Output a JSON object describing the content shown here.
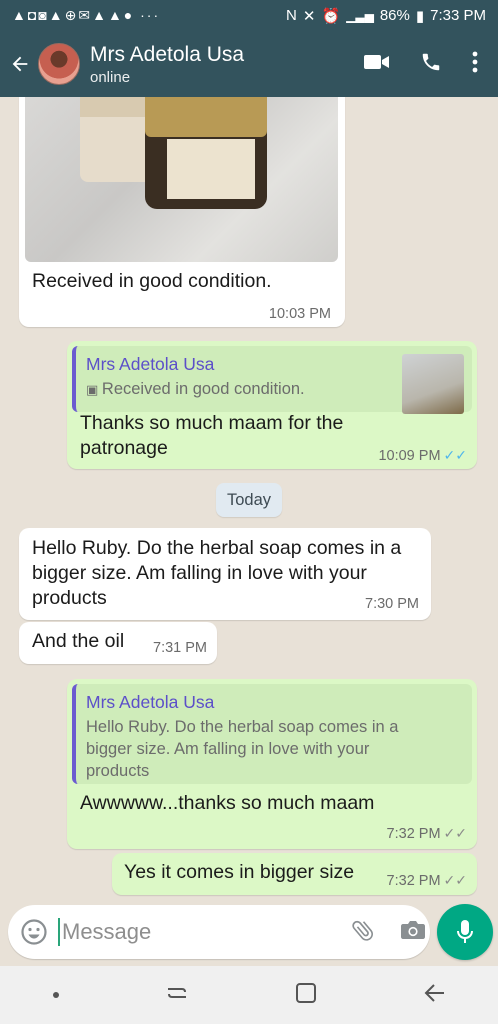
{
  "status_bar": {
    "left_icons": "▲◘◙▲⊕✉▲▲● ···",
    "battery": "86%",
    "time": "7:33 PM"
  },
  "header": {
    "contact_name": "Mrs Adetola Usa",
    "status": "online",
    "icons": [
      "back-arrow-icon",
      "video-call-icon",
      "phone-icon",
      "more-vert-icon"
    ]
  },
  "messages": [
    {
      "direction": "in",
      "type": "image",
      "caption": "Received in good condition.",
      "time": "10:03 PM"
    },
    {
      "direction": "out",
      "quote": {
        "author": "Mrs Adetola Usa",
        "text": "Received in good condition."
      },
      "text": "Thanks so much maam for the patronage",
      "time": "10:09 PM",
      "ticks": "read"
    },
    {
      "type": "date",
      "text": "Today"
    },
    {
      "direction": "in",
      "text": "Hello Ruby. Do the herbal soap comes in a bigger size. Am falling in love with your products",
      "time": "7:30 PM"
    },
    {
      "direction": "in",
      "text": "And the oil",
      "time": "7:31 PM"
    },
    {
      "direction": "out",
      "quote": {
        "author": "Mrs Adetola Usa",
        "text": "Hello Ruby. Do the herbal soap comes in a bigger size. Am falling in love with your products"
      },
      "text": "Awwwww...thanks so much maam",
      "time": "7:32 PM",
      "ticks": "delivered"
    },
    {
      "direction": "out",
      "text": "Yes it comes in bigger size",
      "time": "7:32 PM",
      "ticks": "delivered"
    }
  ],
  "input": {
    "placeholder": "Message"
  },
  "colors": {
    "header": "#33535d",
    "outgoing": "#dcf8c6",
    "incoming": "#ffffff",
    "accent": "#00a884",
    "read_ticks": "#4fb6ec"
  }
}
